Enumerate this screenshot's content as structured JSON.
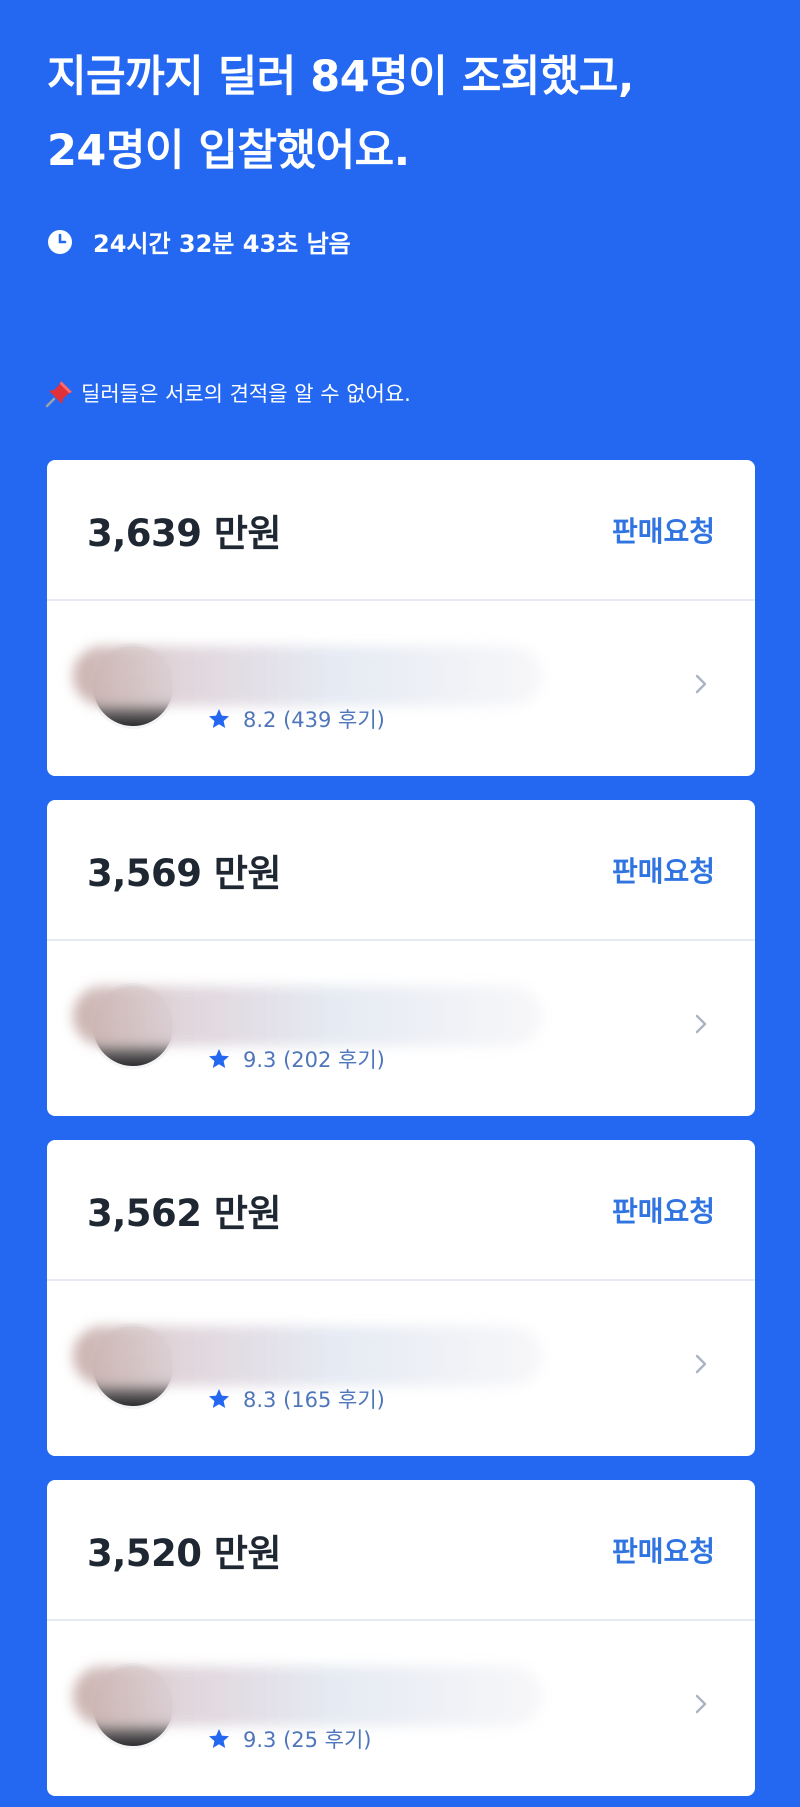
{
  "header": {
    "headline_line1": "지금까지 딜러 84명이 조회했고,",
    "headline_line2": "24명이 입찰했어요.",
    "timer_icon": "clock-icon",
    "timer_text": "24시간 32분 43초 남음"
  },
  "notice": {
    "icon": "pushpin-icon",
    "text": "딜러들은 서로의 견적을 알 수 없어요."
  },
  "colors": {
    "background": "#2468f2",
    "card": "#ffffff",
    "accent": "#2f74e0",
    "price_text": "#1f2733",
    "rating_text": "#4f76ba"
  },
  "offers": [
    {
      "price": "3,639 만원",
      "action": "판매요청",
      "rating": "8.2 (439 후기)"
    },
    {
      "price": "3,569 만원",
      "action": "판매요청",
      "rating": "9.3 (202 후기)"
    },
    {
      "price": "3,562 만원",
      "action": "판매요청",
      "rating": "8.3 (165 후기)"
    },
    {
      "price": "3,520 만원",
      "action": "판매요청",
      "rating": "9.3 (25 후기)"
    }
  ]
}
